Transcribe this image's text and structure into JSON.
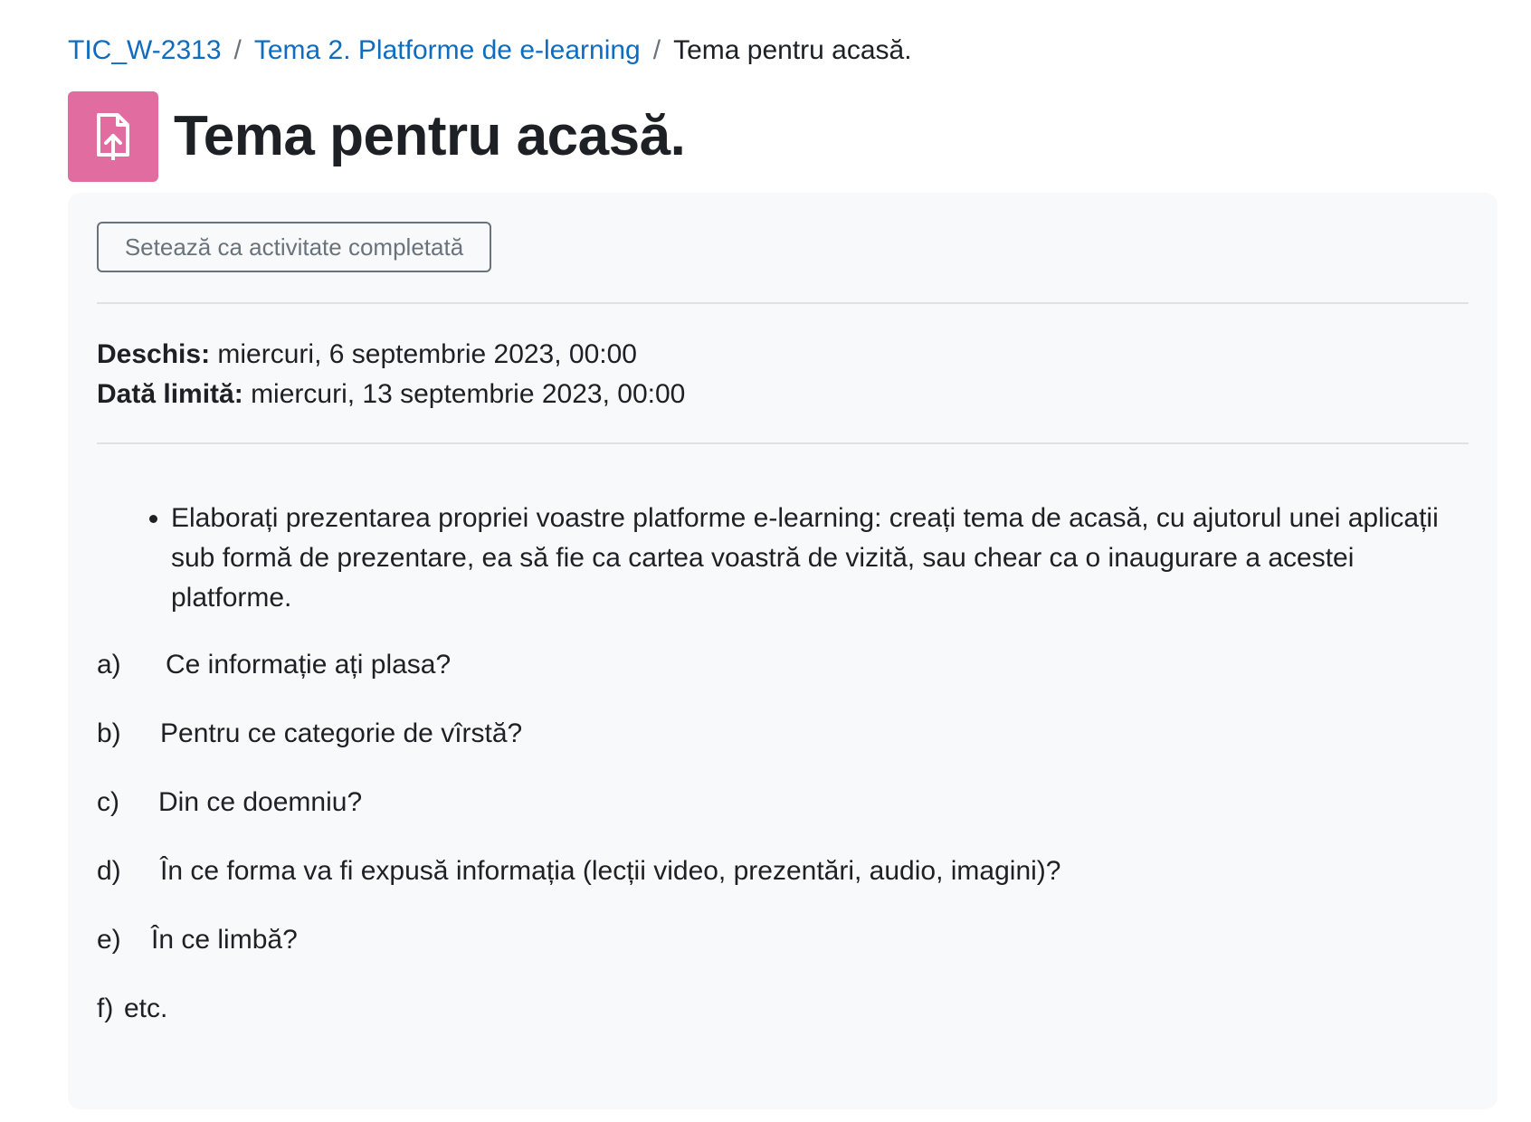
{
  "breadcrumb": {
    "course": "TIC_W-2313",
    "section": "Tema 2. Platforme de e-learning",
    "current": "Tema pentru acasă.",
    "separator": "/"
  },
  "header": {
    "icon": "assignment-upload-icon",
    "icon_color": "#e06ca0",
    "title": "Tema pentru acasă."
  },
  "completion": {
    "button_label": "Setează ca activitate completată"
  },
  "dates": {
    "opened_label": "Deschis:",
    "opened_value": "miercuri, 6 septembrie 2023, 00:00",
    "due_label": "Dată limită:",
    "due_value": "miercuri, 13 septembrie 2023, 00:00"
  },
  "description": {
    "bullet": "Elaborați prezentarea propriei voastre platforme e-learning: creați tema de acasă, cu ajutorul unei aplicații sub formă de prezentare, ea să fie ca cartea voastră de vizită, sau chear ca o inaugurare a acestei platforme.",
    "questions": [
      {
        "letter": "a)",
        "text": "Ce informație ați plasa?"
      },
      {
        "letter": "b)",
        "text": "Pentru ce categorie de vîrstă?"
      },
      {
        "letter": "c)",
        "text": "Din ce doemniu?"
      },
      {
        "letter": "d)",
        "text": "În ce forma va fi expusă informația (lecții video, prezentări, audio, imagini)?"
      },
      {
        "letter": "e)",
        "text": "În ce limbă?"
      },
      {
        "letter": "f)",
        "text": "etc."
      }
    ]
  },
  "colors": {
    "link": "#0f6cbf",
    "card_background": "#f8f9fa",
    "button_border": "#6a737b"
  }
}
